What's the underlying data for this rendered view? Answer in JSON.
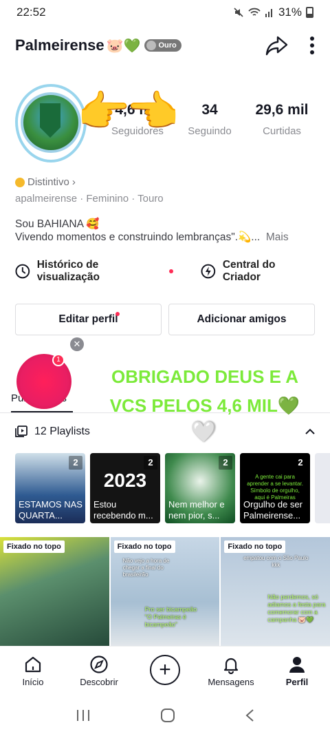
{
  "status": {
    "time": "22:52",
    "battery": "31%"
  },
  "profile": {
    "username": "Palmeirense",
    "username_emojis": "🐷💚",
    "badge_label": "Ouro",
    "stats": [
      {
        "value": "4,6 mil",
        "label": "Seguidores"
      },
      {
        "value": "34",
        "label": "Seguindo"
      },
      {
        "value": "29,6 mil",
        "label": "Curtidas"
      }
    ],
    "distintivo": "Distintivo",
    "meta": "apalmeirense · Feminino · Touro",
    "bio_line1": "Sou BAHIANA 🥰",
    "bio_line2": "Vivendo momentos e construindo lembranças\".💫...",
    "bio_more": "Mais"
  },
  "shortcuts": {
    "history": "Histórico de visualização",
    "creator": "Central do Criador"
  },
  "buttons": {
    "edit": "Editar perfil",
    "add_friends": "Adicionar amigos"
  },
  "tab": {
    "label": "Publicações",
    "live_count": "1"
  },
  "overlay": {
    "text": "OBRIGADO DEUS E A VCS PELOS 4,6 MIL💚"
  },
  "playlists": {
    "header": "12 Playlists",
    "items": [
      {
        "title": "ESTAMOS NAS QUARTA...",
        "count": "2"
      },
      {
        "title": "Estou recebendo m...",
        "count": "2",
        "big_text": "2023"
      },
      {
        "title": "Nem melhor e nem pior, s...",
        "count": "2"
      },
      {
        "title": "Orgulho de ser Palmeirense...",
        "count": "2",
        "green_text": "A gente cai para aprender a se levantar. Símbolo de orgulho, aqui é Palmeiras"
      },
      {
        "title": "",
        "count": ""
      }
    ]
  },
  "pinned": {
    "tag": "Fixado no topo",
    "items": [
      {
        "caption": ""
      },
      {
        "caption": "Não vejo a hora de chegar a final do brasileirão",
        "green": "Pro ser bicampeão \"O Palmeiras é bicampeão\""
      },
      {
        "caption": "empatou com o São Paulo kkk",
        "green": "Não perdemos, só adiamos a festa para comemorar com a campanha 🐷💚"
      }
    ]
  },
  "nav": {
    "home": "Início",
    "discover": "Descobrir",
    "messages": "Mensagens",
    "profile": "Perfil"
  },
  "colors": {
    "accent": "#fe2c55",
    "overlay_green": "#7cea3a"
  }
}
